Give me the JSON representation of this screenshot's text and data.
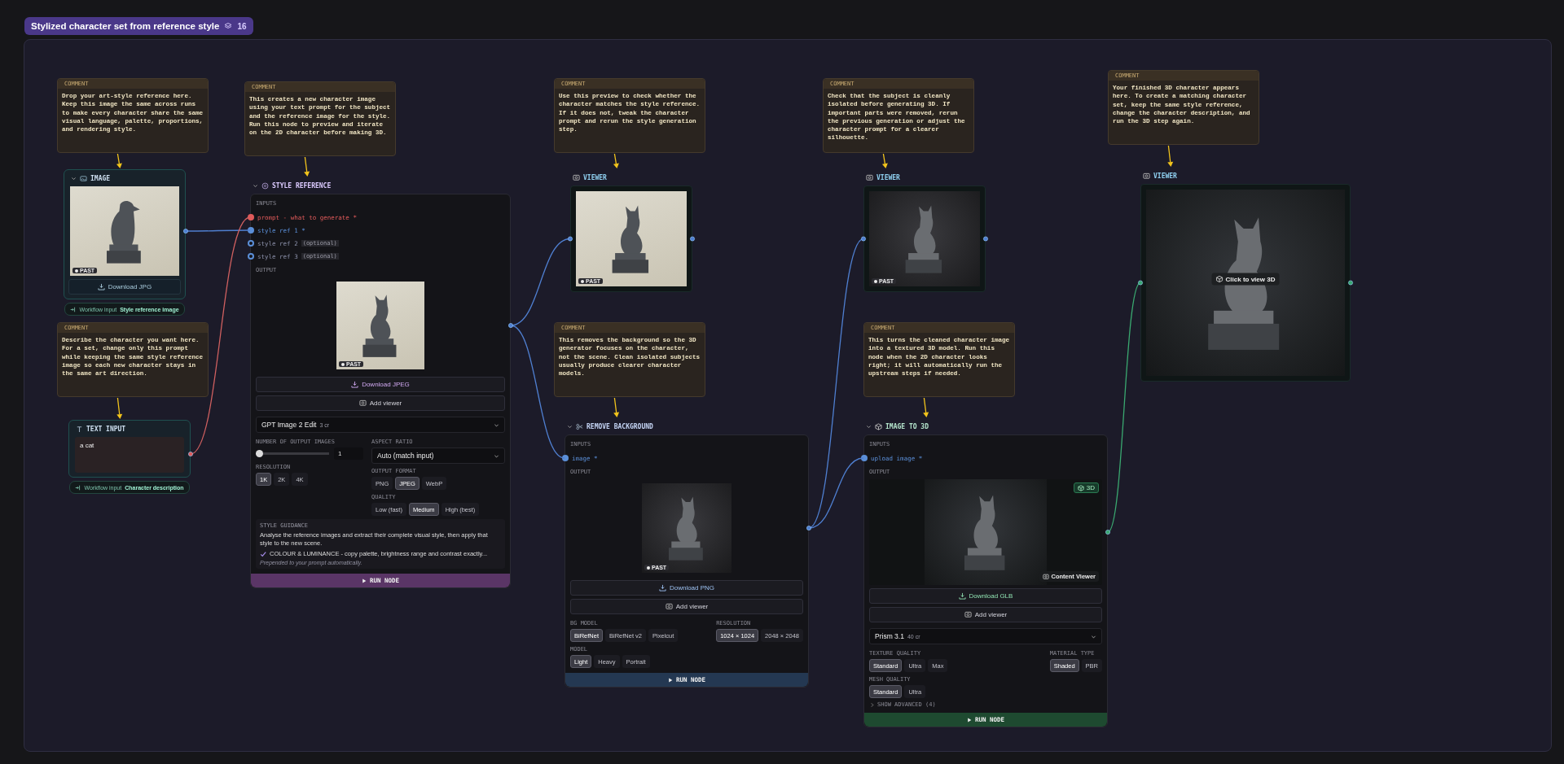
{
  "group": {
    "title": "Stylized character set from reference style",
    "count": "16"
  },
  "comments": [
    {
      "label": "COMMENT",
      "text": "Drop your art-style reference here. Keep this image the same across runs to make every character share the same visual language, palette, proportions, and rendering style."
    },
    {
      "label": "COMMENT",
      "text": "Describe the character you want here. For a set, change only this prompt while keeping the same style reference image so each new character stays in the same art direction."
    },
    {
      "label": "COMMENT",
      "text": "This creates a new character image using your text prompt for the subject and the reference image for the style. Run this node to preview and iterate on the 2D character before making 3D."
    },
    {
      "label": "COMMENT",
      "text": "Use this preview to check whether the character matches the style reference. If it does not, tweak the character prompt and rerun the style generation step."
    },
    {
      "label": "COMMENT",
      "text": "This removes the background so the 3D generator focuses on the character, not the scene. Clean isolated subjects usually produce clearer character models."
    },
    {
      "label": "COMMENT",
      "text": "Check that the subject is cleanly isolated before generating 3D. If important parts were removed, rerun the previous generation or adjust the character prompt for a clearer silhouette."
    },
    {
      "label": "COMMENT",
      "text": "This turns the cleaned character image into a textured 3D model. Run this node when the 2D character looks right; it will automatically run the upstream steps if needed."
    },
    {
      "label": "COMMENT",
      "text": "Your finished 3D character appears here. To create a matching character set, keep the same style reference, change the character description, and run the 3D step again."
    }
  ],
  "nodes": [
    {
      "kind": "image",
      "title": "IMAGE",
      "image_tag": "PAST",
      "buttons": [
        {
          "label": "Download JPG"
        }
      ],
      "workflow_badge": {
        "label": "Workflow input",
        "value": "Style reference image"
      }
    },
    {
      "kind": "text_input",
      "title": "TEXT INPUT",
      "value": "a cat",
      "workflow_badge": {
        "label": "Workflow input",
        "value": "Character description"
      }
    },
    {
      "kind": "generator",
      "title": "STYLE REFERENCE",
      "inputs_label": "INPUTS",
      "inputs": [
        {
          "name": "prompt - what to generate *",
          "connected": true,
          "color": "#e05a5a"
        },
        {
          "name": "style ref 1 *",
          "connected": true,
          "color": "#5b8fd8"
        },
        {
          "name": "style ref 2",
          "note": "(optional)",
          "connected": false,
          "color": "#5b8fd8"
        },
        {
          "name": "style ref 3",
          "note": "(optional)",
          "connected": false,
          "color": "#5b8fd8"
        }
      ],
      "output_label": "OUTPUT",
      "image_tag": "PAST",
      "buttons": [
        {
          "label": "Download JPEG"
        },
        {
          "label": "Add viewer"
        }
      ],
      "model": {
        "value": "GPT Image 2 Edit",
        "cost": "3 cr"
      },
      "settings": [
        [
          {
            "kind": "slider",
            "label": "NUMBER OF OUTPUT IMAGES",
            "level": 0,
            "value": "1"
          },
          {
            "kind": "options",
            "label": "RESOLUTION",
            "options": [
              {
                "label": "1K",
                "selected": true
              },
              {
                "label": "2K",
                "selected": false
              },
              {
                "label": "4K",
                "selected": false
              }
            ]
          }
        ],
        [
          {
            "kind": "select",
            "label": "ASPECT RATIO",
            "value": "Auto (match input)"
          },
          {
            "kind": "options",
            "label": "OUTPUT FORMAT",
            "options": [
              {
                "label": "PNG",
                "selected": false
              },
              {
                "label": "JPEG",
                "selected": true
              },
              {
                "label": "WebP",
                "selected": false
              }
            ]
          },
          {
            "kind": "options",
            "label": "QUALITY",
            "options": [
              {
                "label": "Low (fast)",
                "selected": false
              },
              {
                "label": "Medium",
                "selected": true
              },
              {
                "label": "High (best)",
                "selected": false
              }
            ]
          }
        ]
      ],
      "guidance": {
        "title": "STYLE GUIDANCE",
        "text": "Analyse the reference images and extract their complete visual style, then apply that style to the new scene.",
        "item": {
          "checked": true,
          "text": "COLOUR & LUMINANCE - copy palette, brightness range and contrast exactly..."
        },
        "note": "Prepended to your prompt automatically."
      },
      "run_label": "RUN NODE"
    },
    {
      "kind": "viewer",
      "title": "VIEWER",
      "image_tag": "PAST"
    },
    {
      "kind": "generator",
      "title": "REMOVE BACKGROUND",
      "inputs_label": "INPUTS",
      "inputs": [
        {
          "name": "image *",
          "connected": true,
          "color": "#5b8fd8"
        }
      ],
      "output_label": "OUTPUT",
      "image_tag": "PAST",
      "buttons": [
        {
          "label": "Download PNG"
        },
        {
          "label": "Add viewer"
        }
      ],
      "settings": [
        [
          {
            "kind": "options",
            "label": "BG MODEL",
            "options": [
              {
                "label": "BiRefNet",
                "selected": true
              },
              {
                "label": "BiRefNet v2",
                "selected": false
              },
              {
                "label": "Pixelcut",
                "selected": false
              }
            ]
          },
          {
            "kind": "options",
            "label": "MODEL",
            "options": [
              {
                "label": "Light",
                "selected": true
              },
              {
                "label": "Heavy",
                "selected": false
              },
              {
                "label": "Portrait",
                "selected": false
              }
            ]
          }
        ],
        [
          {
            "kind": "options",
            "label": "RESOLUTION",
            "options": [
              {
                "label": "1024 × 1024",
                "selected": true
              },
              {
                "label": "2048 × 2048",
                "selected": false
              }
            ]
          }
        ]
      ],
      "run_label": "RUN NODE"
    },
    {
      "kind": "viewer",
      "title": "VIEWER",
      "image_tag": "PAST"
    },
    {
      "kind": "generator",
      "title": "IMAGE TO 3D",
      "inputs_label": "INPUTS",
      "inputs": [
        {
          "name": "upload image *",
          "connected": true,
          "color": "#5b8fd8"
        }
      ],
      "output_label": "OUTPUT",
      "badge": "3D",
      "viewer_button": "Content Viewer",
      "buttons": [
        {
          "label": "Download GLB"
        },
        {
          "label": "Add viewer"
        }
      ],
      "model": {
        "value": "Prism 3.1",
        "cost": "40 cr"
      },
      "settings": [
        [
          {
            "kind": "options",
            "label": "TEXTURE QUALITY",
            "options": [
              {
                "label": "Standard",
                "selected": true
              },
              {
                "label": "Ultra",
                "selected": false
              },
              {
                "label": "Max",
                "selected": false
              }
            ]
          },
          {
            "kind": "options",
            "label": "MESH QUALITY",
            "options": [
              {
                "label": "Standard",
                "selected": true
              },
              {
                "label": "Ultra",
                "selected": false
              }
            ]
          }
        ],
        [
          {
            "kind": "options",
            "label": "MATERIAL TYPE",
            "options": [
              {
                "label": "Shaded",
                "selected": true
              },
              {
                "label": "PBR",
                "selected": false
              }
            ]
          }
        ]
      ],
      "advanced": {
        "label": "SHOW ADVANCED (4)",
        "expanded": false
      },
      "run_label": "RUN NODE"
    },
    {
      "kind": "viewer",
      "title": "VIEWER",
      "overlay_button": "Click to view 3D"
    }
  ]
}
